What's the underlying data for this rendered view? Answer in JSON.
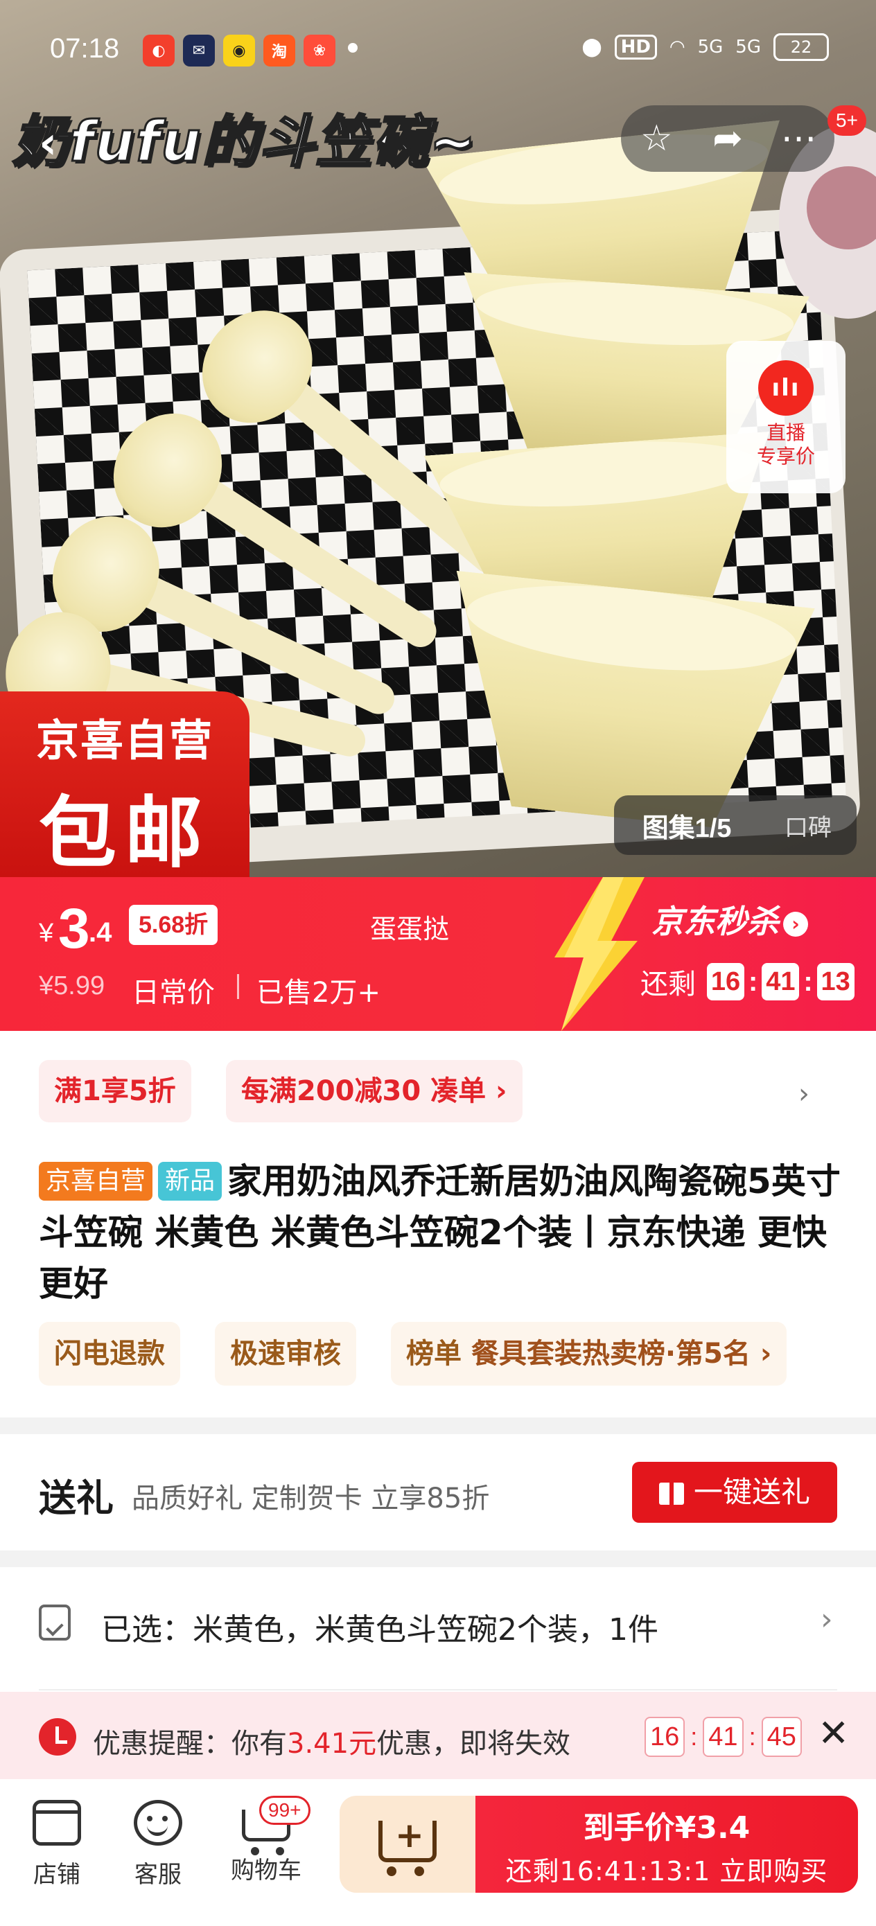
{
  "status_bar": {
    "time": "07:18",
    "network_label": "HD",
    "signal_1": "5G",
    "signal_2": "5G",
    "battery": "22"
  },
  "hero": {
    "title": "奶fufu的斗笠碗~",
    "badge_count": "5+",
    "live": {
      "line1": "直播",
      "line2": "专享价"
    },
    "promo": {
      "line1": "京喜自营",
      "line2": "包邮"
    },
    "gallery": {
      "counter": "图集1/5",
      "reviews": "口碑"
    }
  },
  "price_banner": {
    "currency": "¥",
    "price_int": "3",
    "price_dec": ".4",
    "discount": "5.68折",
    "brand": "蛋蛋挞",
    "original_price": "¥5.99",
    "original_label": "日常价",
    "sold": "已售2万+",
    "event": "京东秒杀",
    "countdown_label": "还剩",
    "countdown": [
      "16",
      "41",
      "13"
    ]
  },
  "info": {
    "coupon_1": "满1享5折",
    "coupon_2": "每满200减30 凑单 ›",
    "tag_self": "京喜自营",
    "tag_new": "新品",
    "title": "家用奶油风乔迁新居奶油风陶瓷碗5英寸斗笠碗 米黄色 米黄色斗笠碗2个装丨京东快递 更快更好",
    "pill_1": "闪电退款",
    "pill_2": "极速审核",
    "rank_label": "榜单",
    "rank_text": "餐具套装热卖榜·第5名 ›"
  },
  "gift": {
    "heading": "送礼",
    "desc": "品质好礼 定制贺卡 立享85折",
    "button": "一键送礼"
  },
  "selected": {
    "text": "已选：米黄色，米黄色斗笠碗2个装，1件"
  },
  "reminder": {
    "prefix": "优惠提醒：你有",
    "amount": "3.41元",
    "suffix": "优惠，即将失效",
    "countdown": [
      "16",
      "41",
      "45"
    ]
  },
  "bottom_bar": {
    "store": "店铺",
    "service": "客服",
    "cart": "购物车",
    "cart_badge": "99+",
    "buy_line1": "到手价¥3.4",
    "buy_line2": "还剩16:41:13:1  立即购买"
  },
  "colors": {
    "brand_red": "#f52b3b",
    "deal_red": "#e3242b",
    "self_operated_tag": "#f37a1e",
    "new_tag": "#47c5d6"
  },
  "icons": [
    "back-icon",
    "star-icon",
    "share-icon",
    "more-icon",
    "live-icon",
    "chevron-right-icon",
    "gift-icon",
    "sku-icon",
    "clock-icon",
    "close-icon",
    "store-icon",
    "service-icon",
    "cart-icon",
    "add-cart-icon"
  ]
}
